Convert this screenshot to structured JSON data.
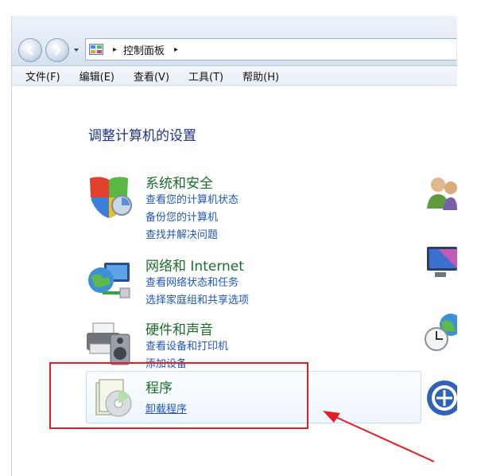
{
  "address_bar": {
    "breadcrumb": "控制面板",
    "separator": "▸",
    "trailing_separator": "▸"
  },
  "menu": [
    "文件(F)",
    "编辑(E)",
    "查看(V)",
    "工具(T)",
    "帮助(H)"
  ],
  "page_title": "调整计算机的设置",
  "categories": [
    {
      "title": "系统和安全",
      "links": [
        "查看您的计算机状态",
        "备份您的计算机",
        "查找并解决问题"
      ],
      "icon": "shield-icon"
    },
    {
      "title": "网络和 Internet",
      "links": [
        "查看网络状态和任务",
        "选择家庭组和共享选项"
      ],
      "icon": "network-globe-icon"
    },
    {
      "title": "硬件和声音",
      "links": [
        "查看设备和打印机",
        "添加设备"
      ],
      "icon": "printer-speaker-icon"
    },
    {
      "title": "程序",
      "links": [
        "卸载程序"
      ],
      "icon": "programs-cd-icon"
    }
  ],
  "right_icons": [
    "user-accounts-icon",
    "appearance-monitor-icon",
    "clock-globe-icon",
    "ease-of-access-icon"
  ],
  "colors": {
    "category_title": "#1a6e2c",
    "link": "#1f56bd",
    "page_title": "#1e3287",
    "annotation_red": "#e81c24"
  }
}
